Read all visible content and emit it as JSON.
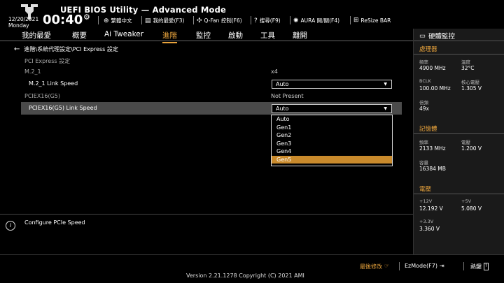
{
  "header": {
    "title": "UEFI BIOS Utility — Advanced Mode",
    "date": "12/20/2021",
    "day": "Monday",
    "time": "00:40",
    "toolbar": [
      {
        "icon": "globe-icon",
        "label": "繁體中文"
      },
      {
        "icon": "favorites-icon",
        "label": "我的最愛(F3)"
      },
      {
        "icon": "fan-icon",
        "label": "Q-Fan 控制(F6)"
      },
      {
        "icon": "help-search-icon",
        "label": "搜尋(F9)"
      },
      {
        "icon": "aura-icon",
        "label": "AURA 開/關(F4)"
      },
      {
        "icon": "resize-bar-icon",
        "label": "ReSize BAR"
      }
    ]
  },
  "menu": [
    {
      "label": "我的最愛",
      "active": false
    },
    {
      "label": "概要",
      "active": false
    },
    {
      "label": "Ai Tweaker",
      "active": false
    },
    {
      "label": "進階",
      "active": true
    },
    {
      "label": "監控",
      "active": false
    },
    {
      "label": "啟動",
      "active": false
    },
    {
      "label": "工具",
      "active": false
    },
    {
      "label": "離開",
      "active": false
    }
  ],
  "main": {
    "breadcrumb": "進階\\系統代理設定\\PCI Express 設定",
    "section_title": "PCI Express 設定",
    "m2_label": "M.2_1",
    "m2_value": "x4",
    "m2_speed_label": "M.2_1 Link Speed",
    "m2_speed_value": "Auto",
    "pciex_label": "PCIEX16(G5)",
    "pciex_value": "Not Present",
    "pciex_speed_label": "PCIEX16(G5) Link Speed",
    "pciex_speed_value": "Auto",
    "options": [
      "Auto",
      "Gen1",
      "Gen2",
      "Gen3",
      "Gen4",
      "Gen5"
    ],
    "highlighted_option": "Gen5",
    "help_text": "Configure PCIe Speed"
  },
  "hw_monitor": {
    "title": "硬體監控",
    "cpu": {
      "heading": "處理器",
      "freq_label": "頻率",
      "freq_value": "4900 MHz",
      "temp_label": "溫度",
      "temp_value": "32°C",
      "bclk_label": "BCLK",
      "bclk_value": "100.00 MHz",
      "vcore_label": "核心電壓",
      "vcore_value": "1.305 V",
      "ratio_label": "倍頻",
      "ratio_value": "49x"
    },
    "memory": {
      "heading": "記憶體",
      "freq_label": "頻率",
      "freq_value": "2133 MHz",
      "volt_label": "電壓",
      "volt_value": "1.200 V",
      "cap_label": "容量",
      "cap_value": "16384 MB"
    },
    "voltage": {
      "heading": "電壓",
      "v12_label": "+12V",
      "v12_value": "12.192 V",
      "v5_label": "+5V",
      "v5_value": "5.080 V",
      "v33_label": "+3.3V",
      "v33_value": "3.360 V"
    }
  },
  "footer": {
    "version": "Version 2.21.1278 Copyright (C) 2021 AMI",
    "last_modified": "最後修改",
    "ezmode": "EzMode(F7)",
    "hotkeys": "熱鍵"
  },
  "colors": {
    "accent": "#e8a33c",
    "highlight": "#c98a2c",
    "selected_row": "#4a4a4a"
  }
}
